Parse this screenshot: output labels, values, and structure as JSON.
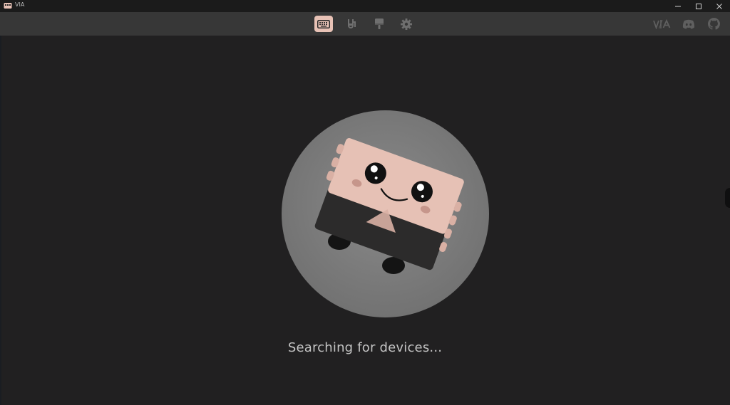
{
  "window": {
    "title": "VIA",
    "controls": [
      "minimize",
      "maximize",
      "close"
    ]
  },
  "nav": {
    "items": [
      {
        "name": "configure",
        "icon": "keyboard-icon",
        "active": true
      },
      {
        "name": "key-tester",
        "icon": "test-tube-icon",
        "active": false
      },
      {
        "name": "design",
        "icon": "paintbrush-icon",
        "active": false
      },
      {
        "name": "settings",
        "icon": "gear-icon",
        "active": false
      }
    ],
    "external": [
      {
        "name": "via-site",
        "icon": "via-logo-icon"
      },
      {
        "name": "discord",
        "icon": "discord-icon"
      },
      {
        "name": "github",
        "icon": "github-icon"
      }
    ]
  },
  "main": {
    "status": "Searching for devices..."
  },
  "colors": {
    "background": "#212021",
    "navbar": "#373737",
    "accent": "#e8c2b6",
    "icon": "#6f6f6f",
    "text": "#c4c4c4"
  }
}
